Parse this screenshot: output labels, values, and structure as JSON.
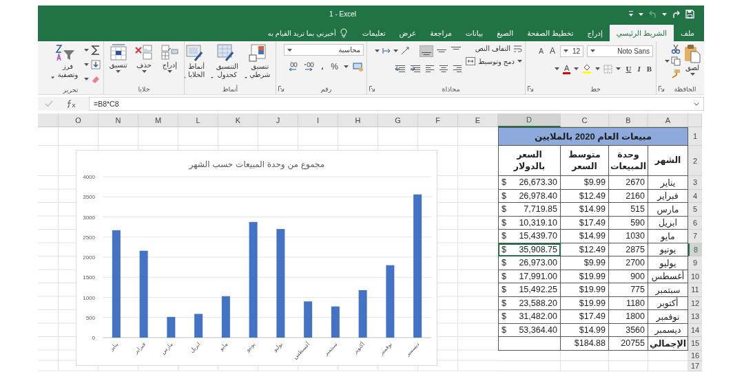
{
  "window": {
    "title": "1 - Excel"
  },
  "tabs": [
    {
      "label": "ملف",
      "selected": false
    },
    {
      "label": "الشريط الرئيسي",
      "selected": true
    },
    {
      "label": "إدراج",
      "selected": false
    },
    {
      "label": "تخطيط الصفحة",
      "selected": false
    },
    {
      "label": "الصيغ",
      "selected": false
    },
    {
      "label": "بيانات",
      "selected": false
    },
    {
      "label": "مراجعة",
      "selected": false
    },
    {
      "label": "عرض",
      "selected": false
    },
    {
      "label": "تعليمات",
      "selected": false
    }
  ],
  "tell_me": {
    "placeholder": "أخبرني بما تريد القيام به"
  },
  "ribbon": {
    "groups": [
      {
        "kind": "clipboard",
        "label": "الحافظة",
        "paste": "لصق"
      },
      {
        "kind": "font",
        "label": "خط",
        "font_name": "Noto Sans",
        "font_size": "12",
        "grow": "A",
        "shrink": "A",
        "bold": "B",
        "italic": "I",
        "underline": "U",
        "font_color": "A"
      },
      {
        "kind": "alignment",
        "label": "محاذاة",
        "wrap": "التفاف النص",
        "merge": "دمج وتوسيط",
        "valign": [
          {
            "selected": false
          },
          {
            "selected": false
          },
          {
            "selected": true
          }
        ]
      },
      {
        "kind": "number",
        "label": "رقم",
        "format": "محاسبة",
        "percent": "%",
        "comma": "،"
      },
      {
        "kind": "styles",
        "label": "أنماط",
        "buttons": [
          "تنسيق شرطي",
          "التنسيق كجدول",
          "أنماط الخلايا"
        ]
      },
      {
        "kind": "cells",
        "label": "خلايا",
        "buttons": [
          "إدراج",
          "حذف",
          "تنسيق"
        ]
      },
      {
        "kind": "editing",
        "label": "تحرير",
        "sort": "فرز وتصفية"
      }
    ]
  },
  "formula_bar": {
    "value": "=B8*C8"
  },
  "column_headers": [
    {
      "label": "A",
      "selected": false
    },
    {
      "label": "B",
      "selected": false
    },
    {
      "label": "C",
      "selected": false
    },
    {
      "label": "D",
      "selected": true
    },
    {
      "label": "E",
      "selected": false
    },
    {
      "label": "F",
      "selected": false
    },
    {
      "label": "G",
      "selected": false
    },
    {
      "label": "H",
      "selected": false
    },
    {
      "label": "I",
      "selected": false
    },
    {
      "label": "J",
      "selected": false
    },
    {
      "label": "K",
      "selected": false
    },
    {
      "label": "L",
      "selected": false
    },
    {
      "label": "M",
      "selected": false
    },
    {
      "label": "N",
      "selected": false
    },
    {
      "label": "O",
      "selected": false
    }
  ],
  "row_headers": [
    {
      "label": "1",
      "selected": false
    },
    {
      "label": "2",
      "selected": false
    },
    {
      "label": "3",
      "selected": false
    },
    {
      "label": "4",
      "selected": false
    },
    {
      "label": "5",
      "selected": false
    },
    {
      "label": "6",
      "selected": false
    },
    {
      "label": "7",
      "selected": false
    },
    {
      "label": "8",
      "selected": true
    },
    {
      "label": "9",
      "selected": false
    },
    {
      "label": "10",
      "selected": false
    },
    {
      "label": "11",
      "selected": false
    },
    {
      "label": "12",
      "selected": false
    },
    {
      "label": "13",
      "selected": false
    },
    {
      "label": "14",
      "selected": false
    },
    {
      "label": "15",
      "selected": false
    },
    {
      "label": "16",
      "selected": false
    },
    {
      "label": "17",
      "selected": false
    }
  ],
  "table": {
    "title": "مبيعات العام 2020 بالملايين",
    "headers": [
      "الشهر",
      "وحدة المبيعات",
      "متوسط السعر",
      "السعر بالدولار"
    ],
    "rows": [
      {
        "month": "يناير",
        "units": "2670",
        "price": "$9.99",
        "currency": "$",
        "amount": "26,673.30",
        "selected": false
      },
      {
        "month": "فبراير",
        "units": "2160",
        "price": "$12.49",
        "currency": "$",
        "amount": "26,978.40",
        "selected": false
      },
      {
        "month": "مارس",
        "units": "515",
        "price": "$14.99",
        "currency": "$",
        "amount": "7,719.85",
        "selected": false
      },
      {
        "month": "ابريل",
        "units": "590",
        "price": "$17.49",
        "currency": "$",
        "amount": "10,319.10",
        "selected": false
      },
      {
        "month": "مايو",
        "units": "1030",
        "price": "$14.99",
        "currency": "$",
        "amount": "15,439.70",
        "selected": false
      },
      {
        "month": "يونيو",
        "units": "2875",
        "price": "$12.49",
        "currency": "$",
        "amount": "35,908.75",
        "selected": true
      },
      {
        "month": "يوليو",
        "units": "2700",
        "price": "$9.99",
        "currency": "$",
        "amount": "26,973.00",
        "selected": false
      },
      {
        "month": "أغسطس",
        "units": "900",
        "price": "$19.99",
        "currency": "$",
        "amount": "17,991.00",
        "selected": false
      },
      {
        "month": "سبتمبر",
        "units": "775",
        "price": "$19.99",
        "currency": "$",
        "amount": "15,492.25",
        "selected": false
      },
      {
        "month": "أكتوبر",
        "units": "1180",
        "price": "$19.99",
        "currency": "$",
        "amount": "23,588.20",
        "selected": false
      },
      {
        "month": "نوفمبر",
        "units": "1800",
        "price": "$17.49",
        "currency": "$",
        "amount": "31,482.00",
        "selected": false
      },
      {
        "month": "ديسمبر",
        "units": "3560",
        "price": "$14.99",
        "currency": "$",
        "amount": "53,364.40",
        "selected": false
      }
    ],
    "total": {
      "label": "الإجمالي",
      "units": "20755",
      "price": "$184.88"
    }
  },
  "chart": {
    "chart_data": {
      "type": "bar",
      "title": "مجموع من وحدة المبيعات حسب الشهر",
      "categories": [
        "يناير",
        "فبراير",
        "مارس",
        "ابريل",
        "مايو",
        "يونيو",
        "يوليو",
        "أغسطس",
        "سبتمبر",
        "أكتوبر",
        "نوفمبر",
        "ديسمبر"
      ],
      "series": [
        {
          "color": "#4472c4",
          "values": [
            2670,
            2160,
            515,
            590,
            1030,
            2875,
            2700,
            900,
            775,
            1180,
            1800,
            3560
          ]
        }
      ],
      "ylim": [
        0,
        4000
      ],
      "grid": true,
      "yticks": [
        0,
        500,
        1000,
        1500,
        2000,
        2500,
        3000,
        3500,
        4000
      ]
    }
  }
}
